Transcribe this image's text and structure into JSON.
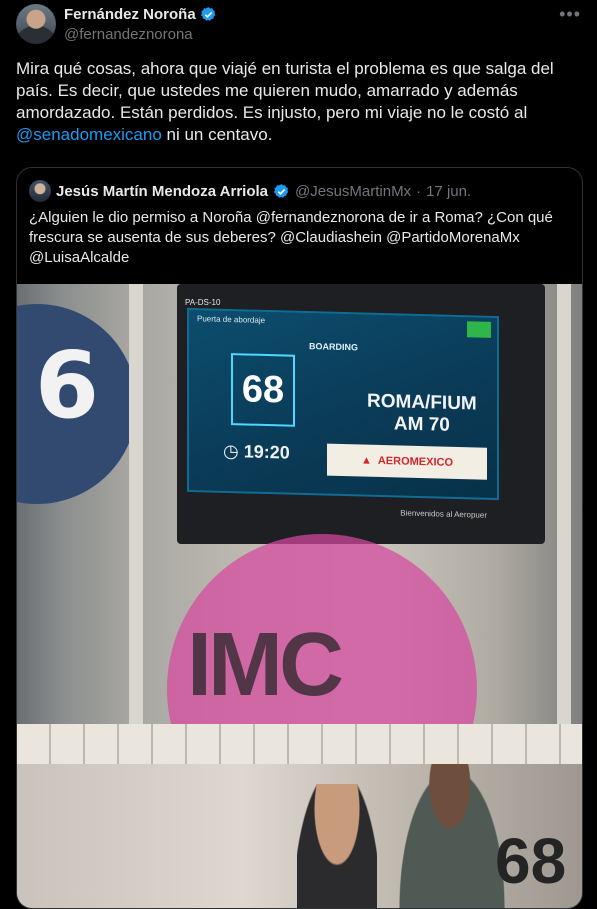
{
  "author": {
    "name": "Fernández Noroña",
    "handle": "@fernandeznorona"
  },
  "post": {
    "text_before": "Mira qué cosas, ahora que viajé en turista el problema es que salga del país. Es decir, que ustedes me quieren mudo, amarrado y además amordazado. Están perdidos. Es injusto, pero mi viaje no le costó al ",
    "mention": "@senadomexicano",
    "text_after": " ni un centavo."
  },
  "quoted": {
    "name": "Jesús Martín Mendoza Arriola",
    "handle": "@JesusMartinMx",
    "separator": "·",
    "date": "17 jun.",
    "text": "¿Alguien le dio permiso a Noroña @fernandeznorona de ir a Roma? ¿Con qué frescura se ausenta de sus deberes? @Claudiashein @PartidoMorenaMx @LuisaAlcalde"
  },
  "photo": {
    "board_code": "PA-DS-10",
    "header": "Puerta de abordaje",
    "status": "BOARDING",
    "gate": "68",
    "destination_line1": "ROMA/FIUM",
    "destination_line2": "AM 70",
    "time": "19:20",
    "airline": "AEROMEXICO",
    "footer": "Bienvenidos al Aeropuer",
    "wall_number": "6",
    "watermark": "IMC",
    "sign_number": "68"
  },
  "icons": [
    "verified-badge-icon",
    "more-icon",
    "clock-icon",
    "aeromexico-logo-icon"
  ],
  "colors": {
    "accent": "#1d9bf0",
    "background": "#000000",
    "muted": "#71767b"
  }
}
